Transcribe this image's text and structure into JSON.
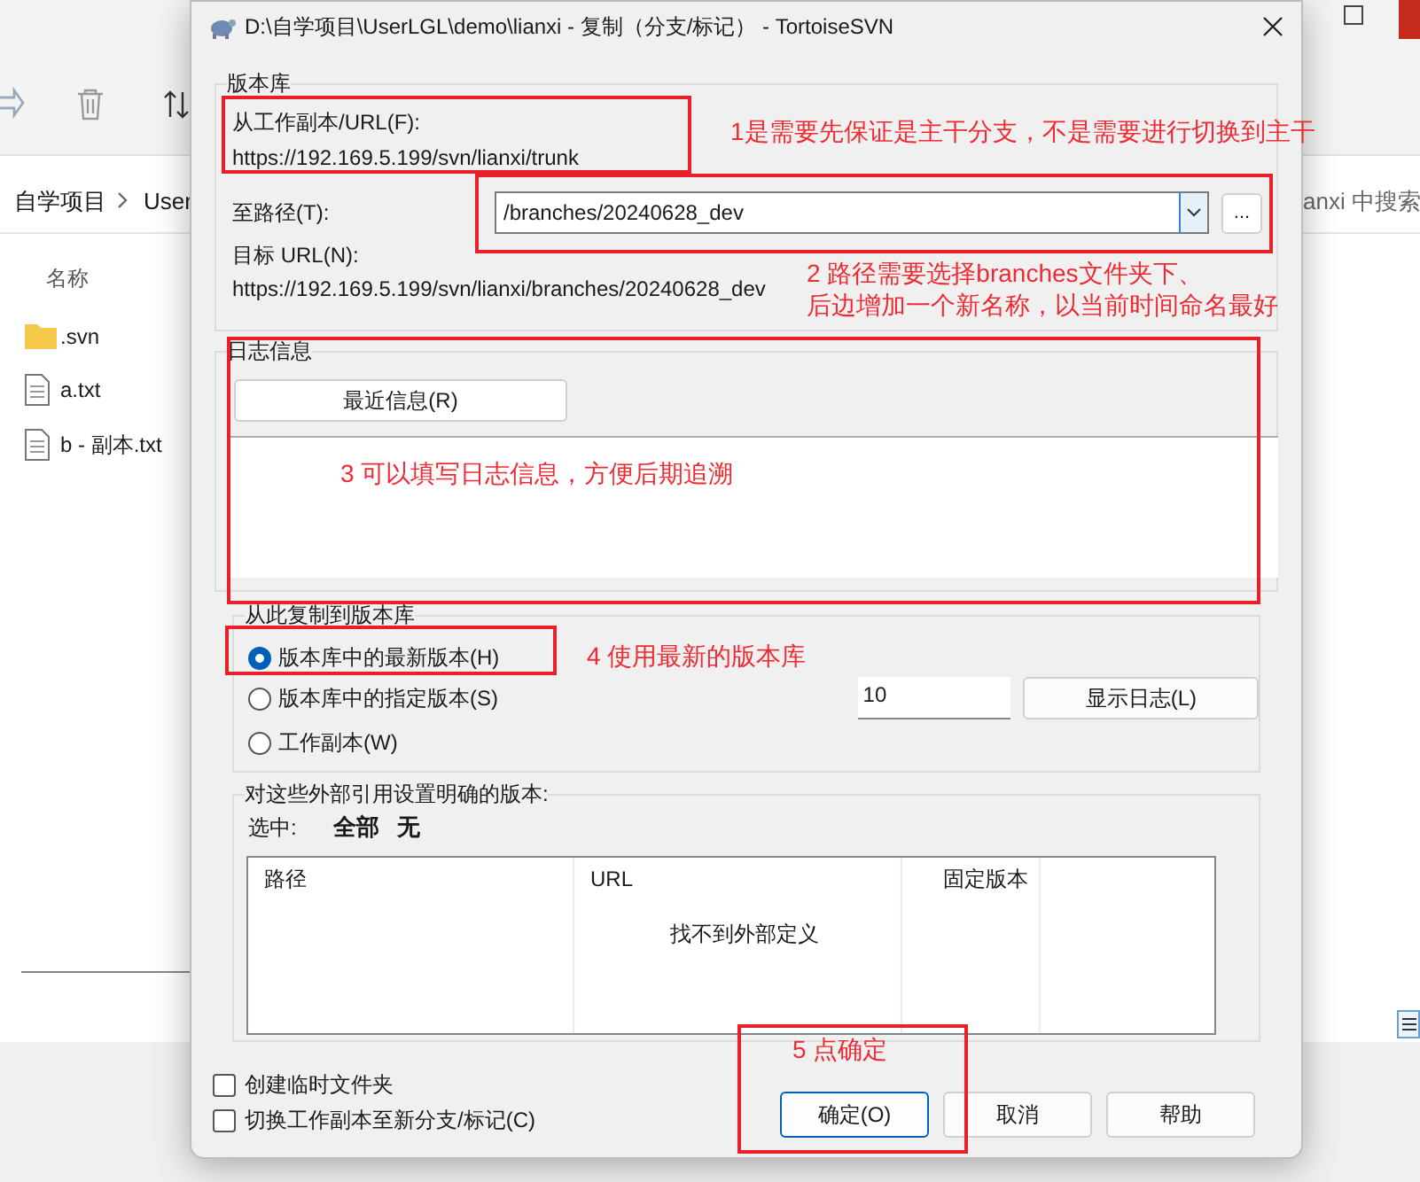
{
  "background_window": {
    "breadcrumb": [
      "自学项目",
      "User"
    ],
    "search_placeholder": "anxi 中搜索",
    "column_header": "名称",
    "files": [
      {
        "name": ".svn",
        "kind": "folder"
      },
      {
        "name": "a.txt",
        "kind": "file"
      },
      {
        "name": "b - 副本.txt",
        "kind": "file"
      }
    ]
  },
  "dialog": {
    "title": "D:\\自学项目\\UserLGL\\demo\\lianxi - 复制（分支/标记） - TortoiseSVN",
    "repository_group": {
      "label": "版本库",
      "from_label": "从工作副本/URL(F):",
      "from_url": "https://192.169.5.199/svn/lianxi/trunk",
      "to_label": "至路径(T):",
      "to_path": "/branches/20240628_dev",
      "browse_button": "...",
      "target_label": "目标 URL(N):",
      "target_url": "https://192.169.5.199/svn/lianxi/branches/20240628_dev"
    },
    "log_group": {
      "label": "日志信息",
      "recent_button": "最近信息(R)"
    },
    "copy_group": {
      "label": "从此复制到版本库",
      "options": [
        {
          "label": "版本库中的最新版本(H)",
          "selected": true
        },
        {
          "label": "版本库中的指定版本(S)",
          "selected": false
        },
        {
          "label": "工作副本(W)",
          "selected": false
        }
      ],
      "revision": "10",
      "show_log_button": "显示日志(L)"
    },
    "externals_group": {
      "label": "对这些外部引用设置明确的版本:",
      "select_label": "选中:",
      "select_all": "全部",
      "select_none": "无",
      "columns": [
        "路径",
        "URL",
        "固定版本"
      ],
      "empty_message": "找不到外部定义"
    },
    "checkboxes": [
      {
        "label": "创建临时文件夹",
        "checked": false
      },
      {
        "label": "切换工作副本至新分支/标记(C)",
        "checked": false
      }
    ],
    "buttons": [
      {
        "label": "确定(O)",
        "default": true
      },
      {
        "label": "取消",
        "default": false
      },
      {
        "label": "帮助",
        "default": false
      }
    ]
  },
  "annotations": [
    {
      "lines": [
        "1是需要先保证是主干分支，不是需要进行切换到主干"
      ]
    },
    {
      "lines": [
        "2 路径需要选择branches文件夹下、",
        "后边增加一个新名称，以当前时间命名最好"
      ]
    },
    {
      "lines": [
        "3 可以填写日志信息，方便后期追溯"
      ]
    },
    {
      "lines": [
        "4 使用最新的版本库"
      ]
    },
    {
      "lines": [
        "5 点确定"
      ]
    }
  ]
}
